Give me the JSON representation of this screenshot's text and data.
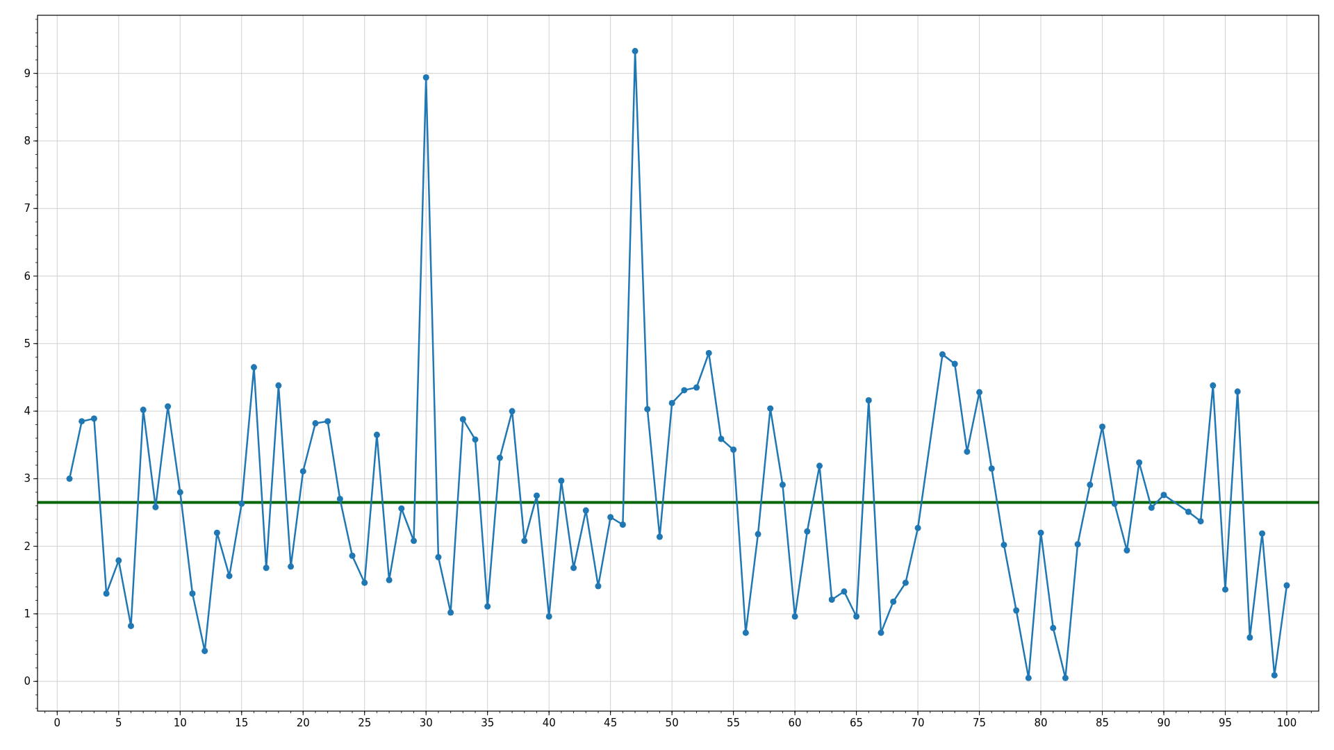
{
  "chart_data": {
    "type": "line",
    "x": [
      1,
      2,
      3,
      4,
      5,
      6,
      7,
      8,
      9,
      10,
      11,
      12,
      13,
      14,
      15,
      16,
      17,
      18,
      19,
      20,
      21,
      22,
      23,
      24,
      25,
      26,
      27,
      28,
      29,
      30,
      31,
      32,
      33,
      34,
      35,
      36,
      37,
      38,
      39,
      40,
      41,
      42,
      43,
      44,
      45,
      46,
      47,
      48,
      49,
      50,
      51,
      52,
      53,
      54,
      55,
      56,
      57,
      58,
      59,
      60,
      61,
      62,
      63,
      64,
      65,
      66,
      67,
      68,
      69,
      70,
      72,
      73,
      74,
      75,
      76,
      77,
      78,
      79,
      80,
      81,
      82,
      83,
      84,
      85,
      86,
      87,
      88,
      89,
      90,
      92,
      93,
      94,
      95,
      96,
      97,
      98,
      99,
      100
    ],
    "series": [
      {
        "color": "#1f77b4",
        "marker": "o",
        "values": [
          3.0,
          3.85,
          3.89,
          1.3,
          1.79,
          0.82,
          4.02,
          2.58,
          4.07,
          2.8,
          1.3,
          0.45,
          2.2,
          1.56,
          2.63,
          4.65,
          1.68,
          4.38,
          1.7,
          3.11,
          3.82,
          3.85,
          2.7,
          1.86,
          1.46,
          3.65,
          1.5,
          2.56,
          2.08,
          8.94,
          1.84,
          1.02,
          3.88,
          3.58,
          1.11,
          3.31,
          4.0,
          2.08,
          2.75,
          0.96,
          2.97,
          1.68,
          2.53,
          1.41,
          2.43,
          2.32,
          9.33,
          4.03,
          2.14,
          4.12,
          4.31,
          4.35,
          4.86,
          3.59,
          3.43,
          0.72,
          2.18,
          4.04,
          2.91,
          0.96,
          2.22,
          3.19,
          1.21,
          1.33,
          0.96,
          4.16,
          0.72,
          1.18,
          1.46,
          2.27,
          4.84,
          4.7,
          3.4,
          4.28,
          3.15,
          2.02,
          1.05,
          0.05,
          2.2,
          0.79,
          0.05,
          2.03,
          2.91,
          3.77,
          2.63,
          1.94,
          3.24,
          2.57,
          2.76,
          2.51,
          2.37,
          4.38,
          1.36,
          4.29,
          0.65,
          2.19,
          0.09,
          1.42
        ]
      }
    ],
    "xlim": [
      -1.6,
      102.6
    ],
    "ylim": [
      -0.44,
      9.86
    ],
    "xticks": [
      0,
      5,
      10,
      15,
      20,
      25,
      30,
      35,
      40,
      45,
      50,
      55,
      60,
      65,
      70,
      75,
      80,
      85,
      90,
      95,
      100
    ],
    "yticks": [
      0,
      1,
      2,
      3,
      4,
      5,
      6,
      7,
      8,
      9
    ],
    "grid": true,
    "ref_lines": [
      {
        "axis": "y",
        "value": 2.65,
        "color": "#006400"
      }
    ]
  }
}
